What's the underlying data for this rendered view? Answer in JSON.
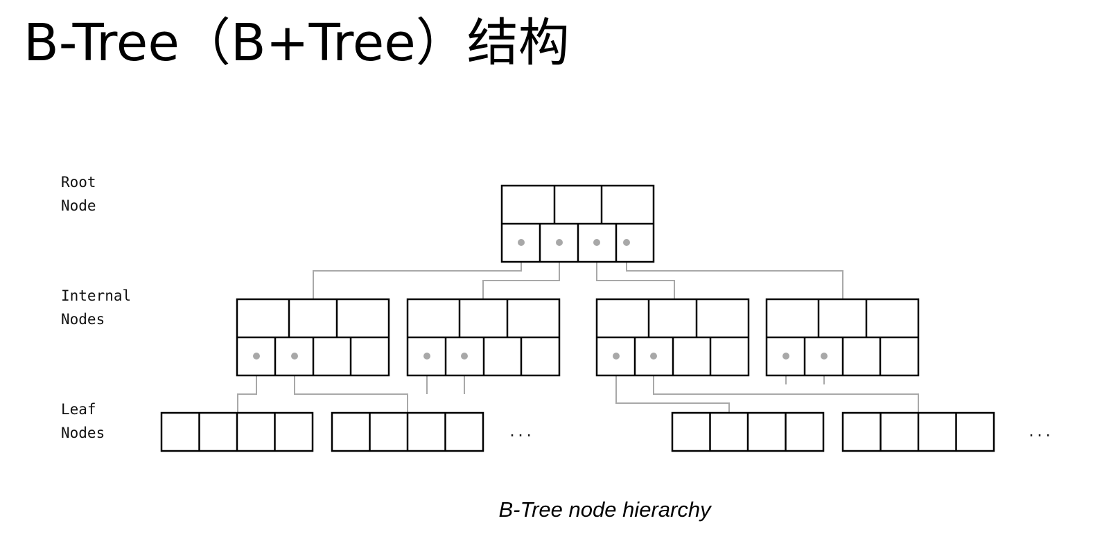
{
  "title": "B-Tree（B+Tree）结构",
  "diagram": {
    "level_labels": {
      "root": [
        "Root",
        "Node"
      ],
      "internal": [
        "Internal",
        "Nodes"
      ],
      "leaf": [
        "Leaf",
        "Nodes"
      ]
    },
    "ellipsis": "...",
    "caption": "B-Tree node hierarchy",
    "colors": {
      "box_stroke": "#000000",
      "connector": "#a8a8a8",
      "pointer_dot": "#a8a8a8"
    }
  }
}
